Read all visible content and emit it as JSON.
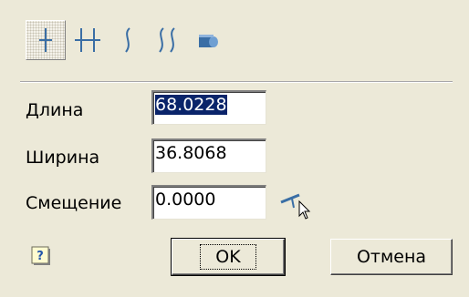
{
  "toolbar": {
    "tools": [
      {
        "icon": "single-line-icon",
        "active": true
      },
      {
        "icon": "double-line-icon",
        "active": false
      },
      {
        "icon": "single-curve-icon",
        "active": false
      },
      {
        "icon": "double-curve-icon",
        "active": false
      },
      {
        "icon": "shape-icon",
        "active": false
      }
    ]
  },
  "fields": {
    "length": {
      "label": "Длина",
      "value": "68.0228"
    },
    "width": {
      "label": "Ширина",
      "value": "36.8068"
    },
    "offset": {
      "label": "Смещение",
      "value": "0.0000"
    }
  },
  "buttons": {
    "ok": "OK",
    "cancel": "Отмена"
  },
  "colors": {
    "dialog_bg": "#ece9d8",
    "icon_blue": "#3a6ea5",
    "selection": "#0a246a"
  }
}
